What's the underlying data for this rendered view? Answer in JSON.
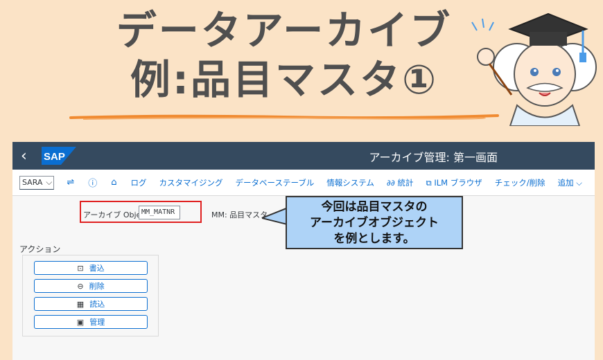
{
  "banner": {
    "title_line1": "データアーカイブ",
    "title_line2": "例:品目マスタ①"
  },
  "shell": {
    "back_icon": "back-arrow-icon",
    "logo_text": "SAP",
    "window_title": "アーカイブ管理: 第一画面"
  },
  "toolbar": {
    "command_value": "SARA",
    "items": [
      "ログ",
      "カスタマイジング",
      "データベーステーブル",
      "情報システム",
      "統計",
      "ILM ブラウザ",
      "チェック/削除",
      "追加"
    ],
    "icons": [
      "command-icon",
      "info-icon",
      "toolbox-icon",
      "statistics-icon",
      "ilm-browser-icon",
      "chevron-down-icon"
    ]
  },
  "archive_object": {
    "label": "アーカイブ Object",
    "value": "MM_MATNR",
    "description": "MM: 品目マスタ"
  },
  "callout": {
    "lines": [
      "今回は品目マスタの",
      "アーカイブオブジェクト",
      "を例とします。"
    ]
  },
  "actions": {
    "title": "アクション",
    "buttons": [
      {
        "label": "書込",
        "icon": "write-icon"
      },
      {
        "label": "削除",
        "icon": "delete-icon"
      },
      {
        "label": "読込",
        "icon": "read-icon"
      },
      {
        "label": "管理",
        "icon": "manage-icon"
      }
    ]
  },
  "colors": {
    "background": "#fbe3c6",
    "shellbar": "#354a5f",
    "accent": "#0a6ed1",
    "highlight": "#e02020",
    "callout": "#aed3f7"
  }
}
